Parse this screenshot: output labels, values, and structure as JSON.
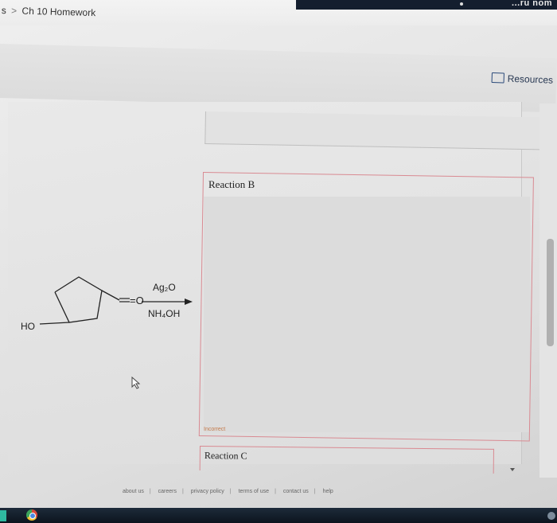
{
  "breadcrumb": {
    "prefix": "s",
    "separator": ">",
    "title": "Ch 10 Homework"
  },
  "brand": {
    "partial_logo": "...ru nom"
  },
  "resources": {
    "label": "Resources",
    "icon": "book-icon"
  },
  "reaction_b": {
    "label": "Reaction B",
    "status": "Incorrect"
  },
  "reaction_c": {
    "label": "Reaction C"
  },
  "reagents": {
    "top": "Ag₂O",
    "bottom": "NH₄OH"
  },
  "molecule": {
    "substituent": "HO",
    "carbonyl": "=O"
  },
  "footer": {
    "links": [
      "about us",
      "careers",
      "privacy policy",
      "terms of use",
      "contact us",
      "help"
    ]
  },
  "colors": {
    "error_border": "#d98a92",
    "incorrect_text": "#c47a4a",
    "taskbar": "#0c141e"
  }
}
